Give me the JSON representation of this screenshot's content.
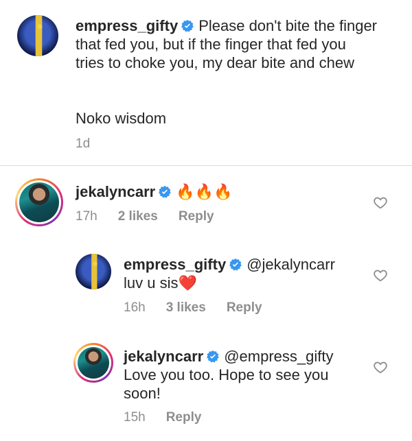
{
  "caption": {
    "username": "empress_gifty",
    "text": "Please don't bite the finger that fed you, but if the finger that fed you tries to choke you, my dear bite and chew",
    "text2": "Noko wisdom",
    "time": "1d"
  },
  "comments": [
    {
      "username": "jekalyncarr",
      "text": "🔥🔥🔥",
      "time": "17h",
      "likes": "2 likes",
      "reply": "Reply"
    },
    {
      "username": "empress_gifty",
      "mention": "@jekalyncarr",
      "text": "luv u sis❤️",
      "time": "16h",
      "likes": "3 likes",
      "reply": "Reply"
    },
    {
      "username": "jekalyncarr",
      "mention": "@empress_gifty",
      "text": "Love you too. Hope to see you soon!",
      "time": "15h",
      "reply": "Reply"
    }
  ],
  "colors": {
    "verified": "#3897f0",
    "meta": "#8e8e8e",
    "text": "#262626"
  }
}
